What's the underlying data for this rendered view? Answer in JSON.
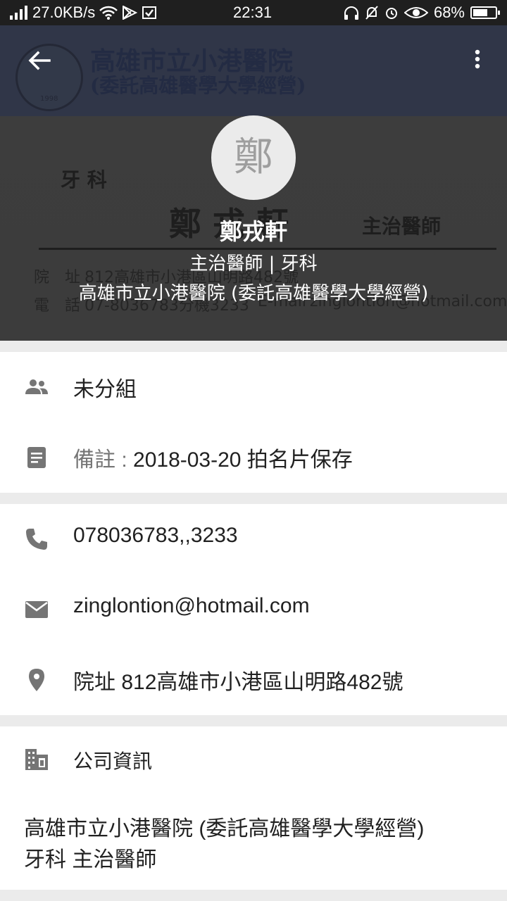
{
  "status_bar": {
    "network_speed": "27.0KB/s",
    "time": "22:31",
    "battery": "68%",
    "battery_level": 0.68
  },
  "card_background": {
    "hospital_name": "高雄市立小港醫院",
    "hospital_sub": "(委託高雄醫學大學經營)",
    "dept": "牙 科",
    "name_big": "鄭 戎 軒",
    "role": "主治醫師",
    "address_label": "院　址",
    "address": "812高雄市小港區山明路482號",
    "phone_label": "電　話",
    "phone": "07-8036783分機3233",
    "email_label": "E-mail",
    "email": "zinglontion@hotmail.com",
    "seal_year": "1998"
  },
  "contact": {
    "avatar_letter": "鄭",
    "name": "鄭戎軒",
    "title_line": "主治醫師 | 牙科",
    "company_line": "高雄市立小港醫院 (委託高雄醫學大學經營)"
  },
  "groups": {
    "label": "未分組"
  },
  "note": {
    "label": "備註 : ",
    "value": "2018-03-20 拍名片保存"
  },
  "phone": {
    "value": "078036783,,3233"
  },
  "email": {
    "value": "zinglontion@hotmail.com"
  },
  "address": {
    "value": "院址 812高雄市小港區山明路482號"
  },
  "company_info": {
    "header": "公司資訊",
    "line1": "高雄市立小港醫院 (委託高雄醫學大學經營)",
    "line2": "牙科  主治醫師"
  }
}
